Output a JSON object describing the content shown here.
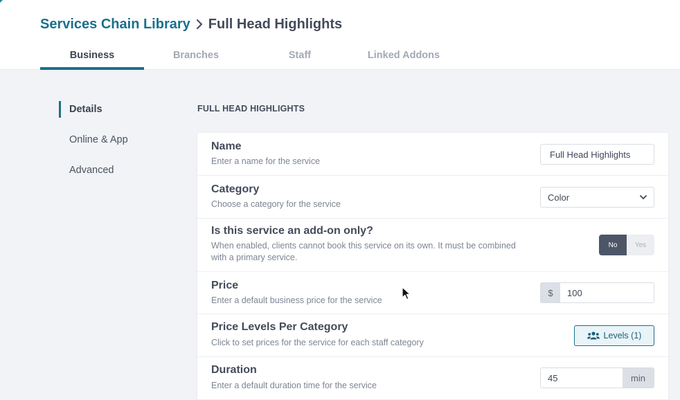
{
  "breadcrumb": {
    "parent": "Services Chain Library",
    "current": "Full Head Highlights"
  },
  "tabs": [
    {
      "label": "Business",
      "active": true
    },
    {
      "label": "Branches",
      "active": false
    },
    {
      "label": "Staff",
      "active": false
    },
    {
      "label": "Linked Addons",
      "active": false
    }
  ],
  "sidenav": [
    {
      "label": "Details",
      "active": true
    },
    {
      "label": "Online & App",
      "active": false
    },
    {
      "label": "Advanced",
      "active": false
    }
  ],
  "section_title": "FULL HEAD HIGHLIGHTS",
  "form": {
    "name": {
      "label": "Name",
      "desc": "Enter a name for the service",
      "value": "Full Head Highlights"
    },
    "category": {
      "label": "Category",
      "desc": "Choose a category for the service",
      "value": "Color"
    },
    "addon": {
      "label": "Is this service an add-on only?",
      "desc": "When enabled, clients cannot book this service on its own. It must be combined with a primary service.",
      "no_label": "No",
      "yes_label": "Yes"
    },
    "price": {
      "label": "Price",
      "desc": "Enter a default business price for the service",
      "currency": "$",
      "value": "100"
    },
    "levels": {
      "label": "Price Levels Per Category",
      "desc": "Click to set prices for the service for each staff category",
      "button": "Levels (1)"
    },
    "duration": {
      "label": "Duration",
      "desc": "Enter a default duration time for the service",
      "value": "45",
      "unit": "min"
    }
  },
  "colors": {
    "accent": "#1b6f8c",
    "toggle_active": "#4d5667"
  }
}
